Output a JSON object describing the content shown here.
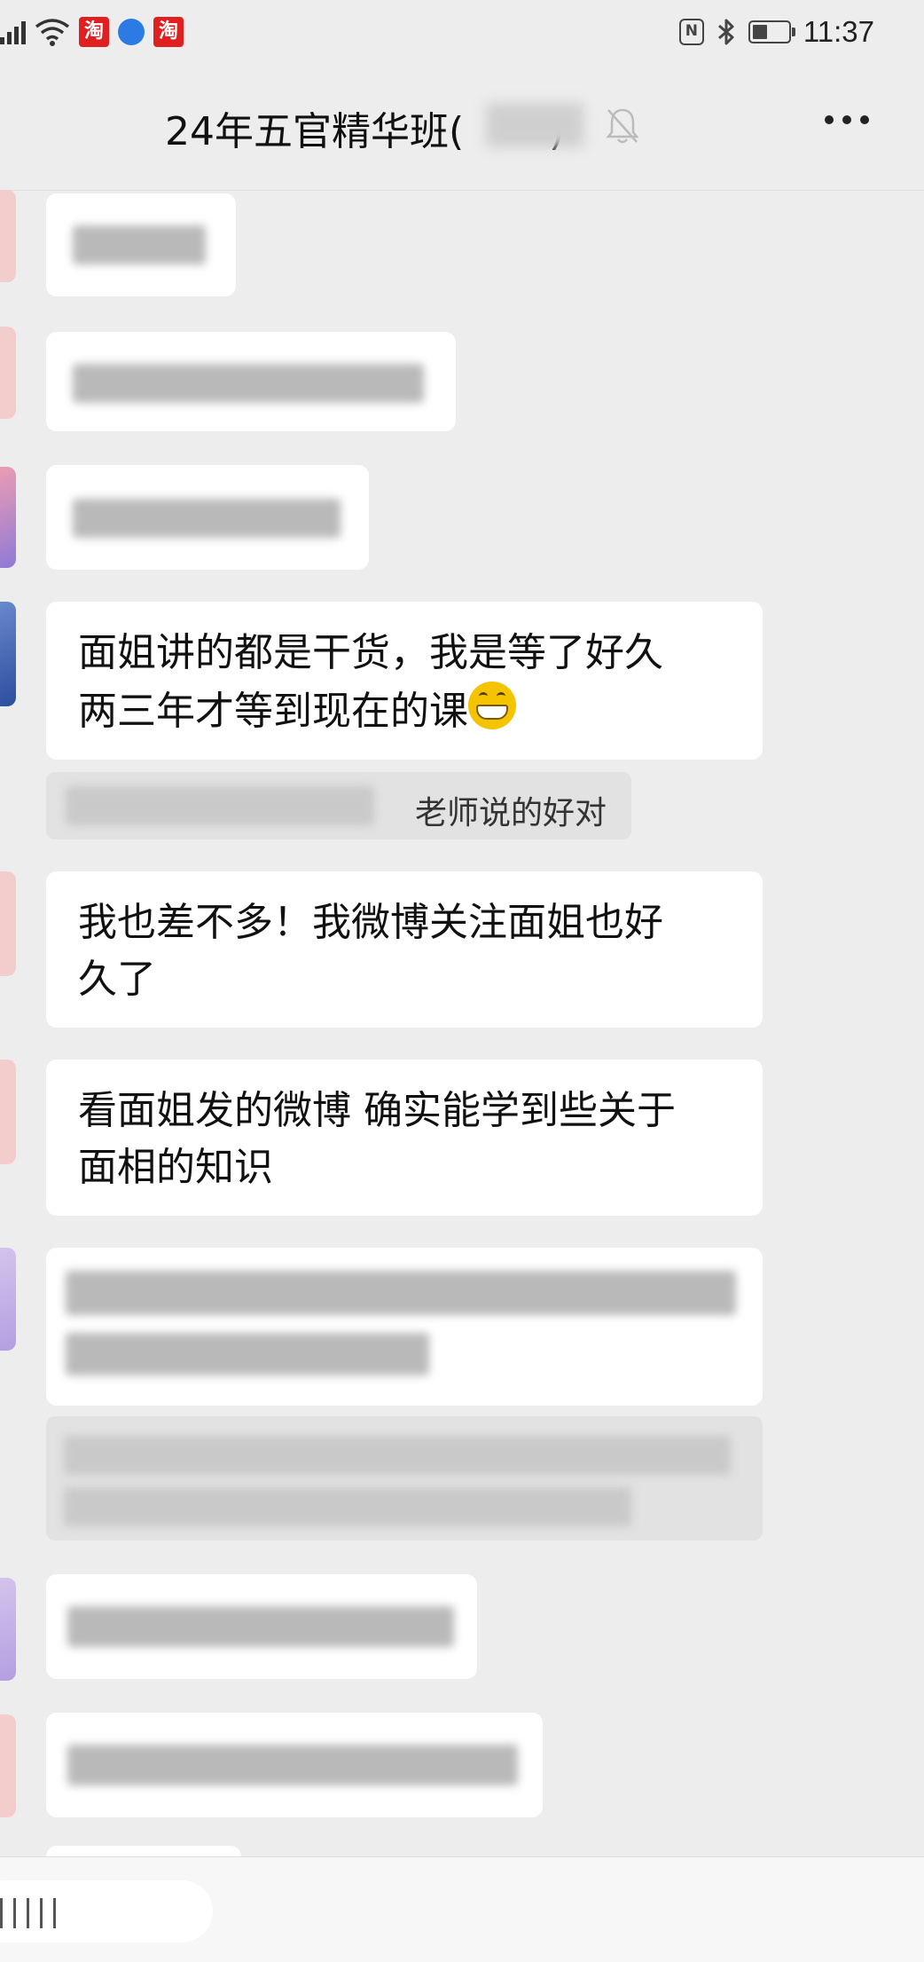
{
  "status_bar": {
    "carrier_badge_1": "淘",
    "carrier_badge_2": "淘",
    "nfc_label": "N",
    "time": "11:37",
    "icons": [
      "signal-icon",
      "wifi-icon",
      "taobao-icon",
      "browser-icon",
      "taobao-618-icon",
      "nfc-icon",
      "bluetooth-icon",
      "battery-icon"
    ]
  },
  "header": {
    "title": "24年五官精华班(",
    "title_suffix": ")",
    "mute_icon": "bell-muted-icon",
    "menu_icon": "more-icon"
  },
  "messages": [
    {
      "text_line_1": "面姐讲的都是干货，我是等了好久",
      "text_line_2": "两三年才等到现在的课",
      "emoji": "grinning-face-icon"
    },
    {
      "quote_text": "老师说的好对"
    },
    {
      "text_line_1": "我也差不多！我微博关注面姐也好",
      "text_line_2": "久了"
    },
    {
      "text_line_1": "看面姐发的微博 确实能学到些关于",
      "text_line_2": "面相的知识"
    }
  ],
  "colors": {
    "background": "#ededed",
    "bubble": "#ffffff",
    "quote": "#e2e2e2",
    "text": "#111111"
  }
}
